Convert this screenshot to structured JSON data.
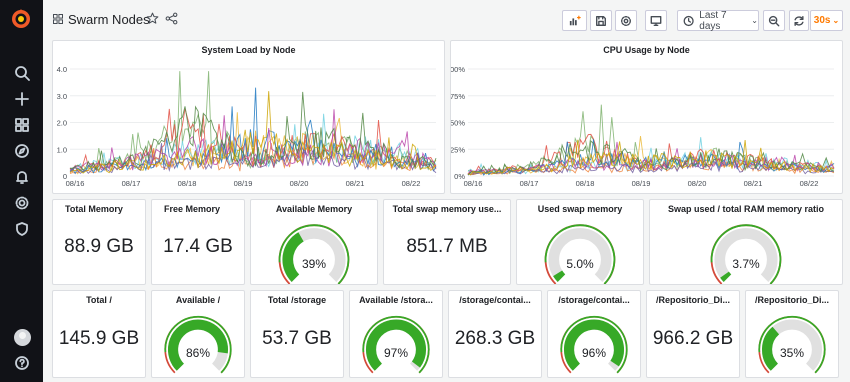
{
  "dashboard": {
    "title": "Swarm Nodes",
    "time_range": "Last 7 days",
    "refresh": "30s",
    "icons": [
      "grid-icon",
      "star-icon",
      "share-icon",
      "add-panel-icon",
      "save-icon",
      "settings-icon",
      "tv-icon",
      "clock-icon",
      "zoom-out-icon",
      "refresh-icon",
      "chevron-down-icon"
    ]
  },
  "sidebar": {
    "icons": [
      "grafana-logo",
      "search-icon",
      "plus-icon",
      "dashboards-icon",
      "explore-icon",
      "alerting-icon",
      "configuration-icon",
      "shield-icon",
      "avatar",
      "help-icon"
    ]
  },
  "colors": {
    "accent": "#ff7a00",
    "gauge_green": "#37a927",
    "gauge_track": "#e0e0e0",
    "threshold_red": "#d44a3a"
  },
  "charts": [
    {
      "title": "System Load by Node",
      "y_ticks": [
        "4.0",
        "3.0",
        "2.0",
        "1.0",
        "0"
      ],
      "x_ticks": [
        "08/16",
        "08/17",
        "08/18",
        "08/19",
        "08/20",
        "08/21",
        "08/22"
      ]
    },
    {
      "title": "CPU Usage by Node",
      "y_ticks": [
        "100%",
        "75%",
        "50%",
        "25%",
        "0%"
      ],
      "x_ticks": [
        "08/16",
        "08/17",
        "08/18",
        "08/19",
        "08/20",
        "08/21",
        "08/22"
      ]
    }
  ],
  "chart_data": [
    {
      "type": "line",
      "title": "System Load by Node",
      "xlabel": "",
      "ylabel": "",
      "ylim": [
        0,
        4
      ],
      "x": [
        "08/16",
        "08/17",
        "08/18",
        "08/19",
        "08/20",
        "08/21",
        "08/22"
      ],
      "series": [
        {
          "values": [
            0.3,
            0.8,
            2.9,
            0.7,
            2.0,
            1.3,
            0.6
          ]
        },
        {
          "values": [
            0.2,
            0.6,
            1.0,
            1.8,
            1.6,
            0.9,
            0.5
          ]
        },
        {
          "values": [
            0.4,
            0.7,
            1.5,
            1.0,
            1.2,
            1.6,
            0.8
          ]
        },
        {
          "values": [
            0.1,
            0.5,
            0.7,
            0.6,
            1.1,
            0.7,
            0.4
          ]
        }
      ]
    },
    {
      "type": "line",
      "title": "CPU Usage by Node",
      "xlabel": "",
      "ylabel": "",
      "ylim": [
        0,
        100
      ],
      "x": [
        "08/16",
        "08/17",
        "08/18",
        "08/19",
        "08/20",
        "08/21",
        "08/22"
      ],
      "series": [
        {
          "values": [
            3,
            10,
            43,
            12,
            28,
            15,
            8
          ]
        },
        {
          "values": [
            2,
            6,
            24,
            20,
            25,
            12,
            10
          ]
        },
        {
          "values": [
            4,
            8,
            18,
            15,
            22,
            18,
            12
          ]
        },
        {
          "values": [
            1,
            5,
            10,
            9,
            16,
            8,
            5
          ]
        }
      ]
    }
  ],
  "stats_row1": [
    {
      "title": "Total Memory",
      "value": "88.9 GB"
    },
    {
      "title": "Free Memory",
      "value": "17.4 GB"
    },
    {
      "title": "Available Memory",
      "gauge": "39%",
      "fraction": 0.39
    },
    {
      "title": "Total swap memory use...",
      "value": "851.7 MB"
    },
    {
      "title": "Used swap memory",
      "gauge": "5.0%",
      "fraction": 0.05
    },
    {
      "title": "Swap used / total RAM memory ratio",
      "gauge": "3.7%",
      "fraction": 0.037
    }
  ],
  "stats_row2": [
    {
      "title": "Total /",
      "value": "145.9 GB"
    },
    {
      "title": "Available /",
      "gauge": "86%",
      "fraction": 0.86
    },
    {
      "title": "Total /storage",
      "value": "53.7 GB"
    },
    {
      "title": "Available /stora...",
      "gauge": "97%",
      "fraction": 0.97
    },
    {
      "title": "/storage/contai...",
      "value": "268.3 GB"
    },
    {
      "title": "/storage/contai...",
      "gauge": "96%",
      "fraction": 0.96
    },
    {
      "title": "/Repositorio_Di...",
      "value": "966.2 GB"
    },
    {
      "title": "/Repositorio_Di...",
      "gauge": "35%",
      "fraction": 0.35
    }
  ]
}
